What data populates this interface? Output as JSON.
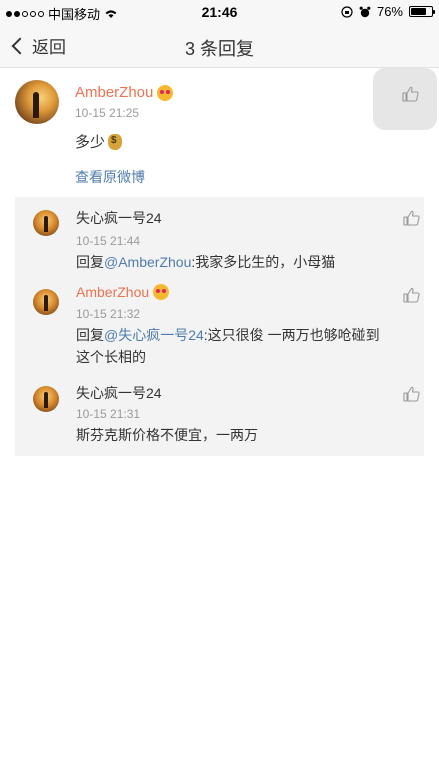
{
  "status_bar": {
    "carrier": "中国移动",
    "time": "21:46",
    "battery": "76%",
    "battery_fraction": 0.76
  },
  "nav": {
    "back_label": "返回",
    "title": "3 条回复"
  },
  "post": {
    "username": "AmberZhou",
    "time": "10-15 21:25",
    "text": "多少",
    "view_original": "查看原微博"
  },
  "replies": [
    {
      "username": "失心疯一号24",
      "time": "10-15 21:44",
      "prefix": "回复",
      "mention": "@AmberZhou",
      "text": ":我家多比生的，小母猫"
    },
    {
      "username": "AmberZhou",
      "time": "10-15 21:32",
      "prefix": "回复",
      "mention": "@失心疯一号24",
      "text": ":这只很俊 一两万也够呛碰到",
      "text2": "这个长相的"
    },
    {
      "username": "失心疯一号24",
      "time": "10-15 21:31",
      "text": "斯芬克斯价格不便宜，一两万"
    }
  ],
  "colors": {
    "username_orange": "#eb7350",
    "link_blue": "#507daf",
    "reply_bg": "#f3f3f3"
  }
}
